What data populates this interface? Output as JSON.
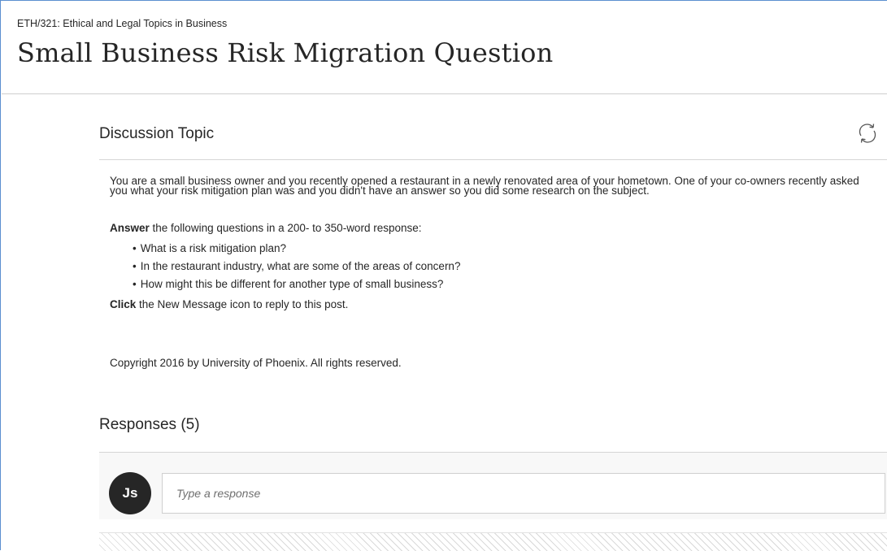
{
  "course": "ETH/321: Ethical and Legal Topics in Business",
  "page_title": "Small Business Risk Migration Question",
  "topic": {
    "heading": "Discussion Topic",
    "refresh_icon": "refresh-icon",
    "paragraph": "You are a small business owner and you recently opened a restaurant in a newly renovated area of your hometown. One of your co-owners recently asked you what your risk mitigation plan was and you didn't have an answer so you did some research on the subject.",
    "answer_bold": "Answer",
    "answer_rest": " the following questions in a 200- to 350-word response:",
    "bullets": [
      "What is a risk mitigation plan?",
      "In the restaurant industry, what are some of the areas of concern?",
      "How might this be different for another type of small business?"
    ],
    "click_bold": "Click",
    "click_rest": " the New Message icon to reply to this post.",
    "copyright": "Copyright 2016 by University of Phoenix. All rights reserved."
  },
  "responses": {
    "heading": "Responses (5)",
    "avatar_initials": "Js",
    "input_placeholder": "Type a response"
  },
  "colors": {
    "frame_border": "#5b8fd0",
    "avatar_bg": "#262626",
    "text": "#262626"
  }
}
